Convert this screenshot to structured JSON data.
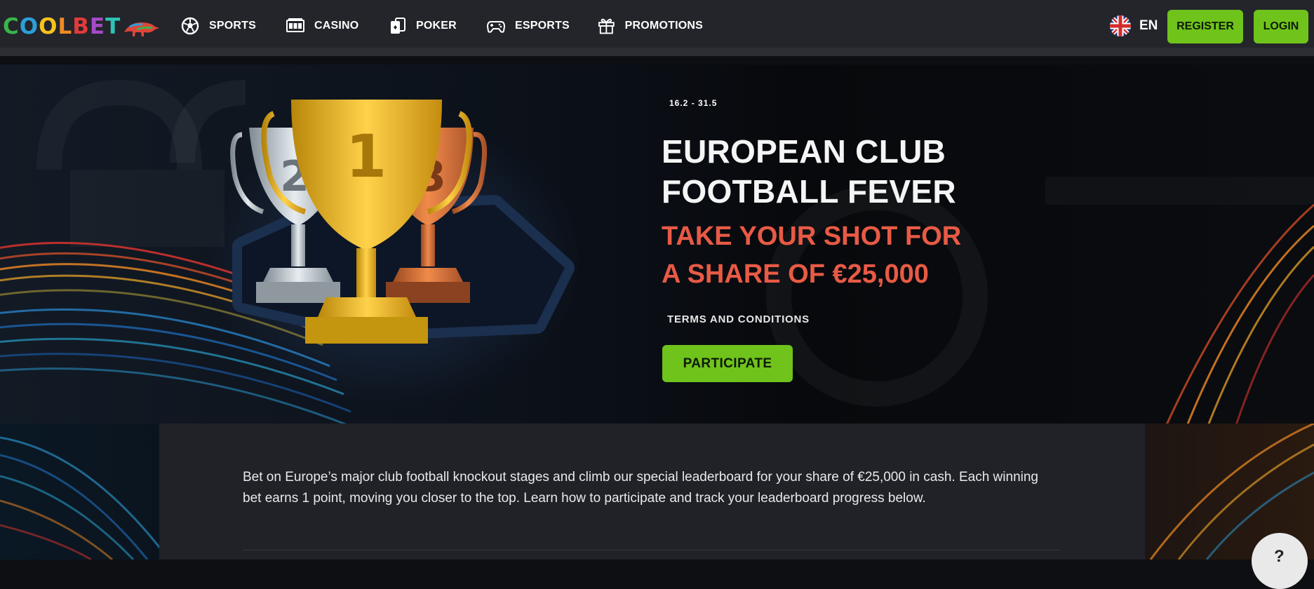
{
  "brand": {
    "logo_letters": [
      "C",
      "O",
      "O",
      "L",
      "B",
      "E",
      "T"
    ],
    "logo_colors": [
      "#39b54a",
      "#2b9fd9",
      "#f7c21b",
      "#f08a24",
      "#e23a3a",
      "#a64bc8",
      "#2ec4b6"
    ]
  },
  "nav": {
    "items": [
      {
        "label": "SPORTS",
        "icon": "football-icon"
      },
      {
        "label": "CASINO",
        "icon": "slot-machine-icon"
      },
      {
        "label": "POKER",
        "icon": "playing-cards-icon"
      },
      {
        "label": "ESPORTS",
        "icon": "gamepad-icon"
      },
      {
        "label": "PROMOTIONS",
        "icon": "gift-icon"
      }
    ]
  },
  "header": {
    "language": "EN",
    "register_label": "REGISTER",
    "login_label": "LOGIN"
  },
  "hero": {
    "dates": "16.2 - 31.5",
    "title_line1": "EUROPEAN CLUB",
    "title_line2": "FOOTBALL FEVER",
    "subtitle_line1": "TAKE YOUR SHOT FOR",
    "subtitle_line2": "A SHARE OF €25,000",
    "terms_label": "TERMS AND CONDITIONS",
    "cta_label": "PARTICIPATE",
    "trophy_ranks": [
      "2",
      "1",
      "3"
    ]
  },
  "content": {
    "description": "Bet on Europe’s major club football knockout stages and climb our special leaderboard for your share of €25,000 in cash. Each winning bet earns 1 point, moving you closer to the top. Learn how to participate and track your leaderboard progress below."
  },
  "help": {
    "icon": "help-icon",
    "glyph": "?"
  },
  "colors": {
    "accent_green": "#6fc31b",
    "subtitle_red": "#e85a45",
    "header_bg": "#23252b",
    "card_bg": "#202227"
  }
}
